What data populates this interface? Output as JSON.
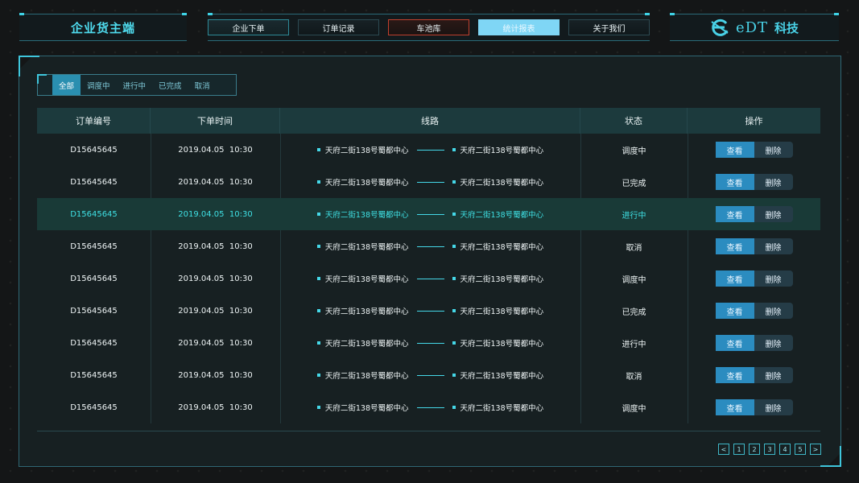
{
  "header": {
    "title": "企业货主端",
    "nav": [
      {
        "label": "企业下单",
        "style": "teal"
      },
      {
        "label": "订单记录",
        "style": "normal"
      },
      {
        "label": "车池库",
        "style": "red"
      },
      {
        "label": "统计报表",
        "style": "active"
      },
      {
        "label": "关于我们",
        "style": "normal"
      }
    ],
    "logo_text": "eDT",
    "logo_cn": "科技"
  },
  "filters": {
    "items": [
      "全部",
      "调度中",
      "进行中",
      "已完成",
      "取消"
    ],
    "active": "全部"
  },
  "table": {
    "columns": [
      "订单编号",
      "下单时间",
      "线路",
      "状态",
      "操作"
    ],
    "view_label": "查看",
    "delete_label": "删除",
    "rows": [
      {
        "id": "D15645645",
        "date": "2019.04.05",
        "time": "10:30",
        "from": "天府二街138号蜀都中心",
        "to": "天府二街138号蜀都中心",
        "status": "调度中"
      },
      {
        "id": "D15645645",
        "date": "2019.04.05",
        "time": "10:30",
        "from": "天府二街138号蜀都中心",
        "to": "天府二街138号蜀都中心",
        "status": "已完成"
      },
      {
        "id": "D15645645",
        "date": "2019.04.05",
        "time": "10:30",
        "from": "天府二街138号蜀都中心",
        "to": "天府二街138号蜀都中心",
        "status": "进行中",
        "highlight": true
      },
      {
        "id": "D15645645",
        "date": "2019.04.05",
        "time": "10:30",
        "from": "天府二街138号蜀都中心",
        "to": "天府二街138号蜀都中心",
        "status": "取消"
      },
      {
        "id": "D15645645",
        "date": "2019.04.05",
        "time": "10:30",
        "from": "天府二街138号蜀都中心",
        "to": "天府二街138号蜀都中心",
        "status": "调度中"
      },
      {
        "id": "D15645645",
        "date": "2019.04.05",
        "time": "10:30",
        "from": "天府二街138号蜀都中心",
        "to": "天府二街138号蜀都中心",
        "status": "已完成"
      },
      {
        "id": "D15645645",
        "date": "2019.04.05",
        "time": "10:30",
        "from": "天府二街138号蜀都中心",
        "to": "天府二街138号蜀都中心",
        "status": "进行中"
      },
      {
        "id": "D15645645",
        "date": "2019.04.05",
        "time": "10:30",
        "from": "天府二街138号蜀都中心",
        "to": "天府二街138号蜀都中心",
        "status": "取消"
      },
      {
        "id": "D15645645",
        "date": "2019.04.05",
        "time": "10:30",
        "from": "天府二街138号蜀都中心",
        "to": "天府二街138号蜀都中心",
        "status": "调度中"
      }
    ]
  },
  "pagination": {
    "prev": "<",
    "pages": [
      "1",
      "2",
      "3",
      "4",
      "5"
    ],
    "next": ">"
  },
  "colors": {
    "accent": "#45d8e8",
    "primary_button": "#2b8cc0",
    "nav_active": "#7fd6f5",
    "nav_alert": "#c0402e"
  }
}
